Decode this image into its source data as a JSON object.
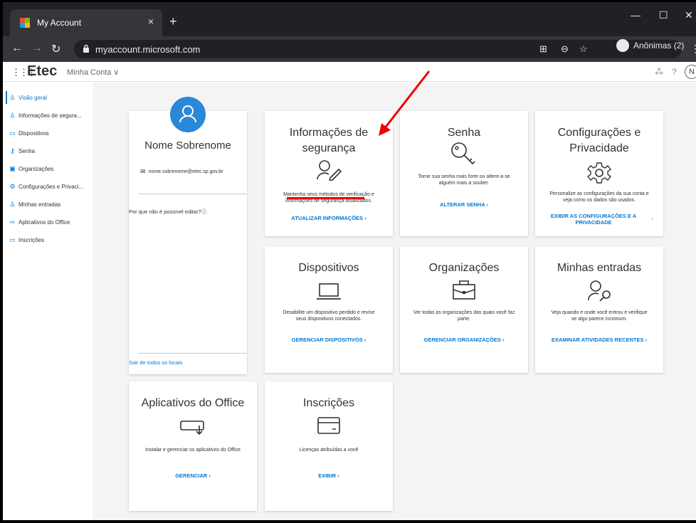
{
  "browser": {
    "tab_title": "My Account",
    "tab_close": "×",
    "new_tab": "+",
    "url": "myaccount.microsoft.com",
    "profile_label": "Anônimas (2)",
    "window_min": "—",
    "window_max": "☐",
    "window_close": "✕"
  },
  "header": {
    "brand": "Etec",
    "subtitle": "Minha Conta ∨",
    "help": "?",
    "avatar_initial": "N"
  },
  "sidebar": {
    "items": [
      {
        "label": "Visão geral",
        "icon": "person-icon"
      },
      {
        "label": "Informações de segura...",
        "icon": "security-info-icon"
      },
      {
        "label": "Dispositivos",
        "icon": "laptop-icon"
      },
      {
        "label": "Senha",
        "icon": "key-icon"
      },
      {
        "label": "Organizações",
        "icon": "briefcase-icon"
      },
      {
        "label": "Configurações e Privaci...",
        "icon": "gear-icon"
      },
      {
        "label": "Minhas entradas",
        "icon": "sign-in-icon"
      },
      {
        "label": "Aplicativos do Office",
        "icon": "office-apps-icon"
      },
      {
        "label": "Inscrições",
        "icon": "card-icon"
      }
    ]
  },
  "profile": {
    "name": "Nome Sobrenome",
    "email": "nome.sobrenome@etec.sp.gov.br",
    "why": "Por que não é possível editar?",
    "signout": "Sair de todos os locais"
  },
  "cards": {
    "security": {
      "title1": "Informações de",
      "title2": "segurança",
      "desc1": "Mantenha seus métodos de verificação e",
      "desc2": "informações de segurança atualizados.",
      "link": "ATUALIZAR INFORMAÇÕES  ›"
    },
    "password": {
      "title": "Senha",
      "desc1": "Torne sua senha mais forte ou altere-a se",
      "desc2": "alguém mais a souber.",
      "link": "ALTERAR SENHA  ›"
    },
    "privacy": {
      "title1": "Configurações e",
      "title2": "Privacidade",
      "desc1": "Personalize as configurações da sua conta e",
      "desc2": "veja como os dados são usados.",
      "link1": "EXIBIR AS CONFIGURAÇÕES E A",
      "link2": "PRIVACIDADE",
      "chevron": "›"
    },
    "devices": {
      "title": "Dispositivos",
      "desc1": "Desabilite um dispositivo perdido e revise",
      "desc2": "seus dispositivos conectados.",
      "link": "GERENCIAR DISPOSITIVOS  ›"
    },
    "orgs": {
      "title": "Organizações",
      "desc1": "Ver todas as organizações das quais você faz",
      "desc2": "parte.",
      "link": "GERENCIAR ORGANIZAÇÕES  ›"
    },
    "signins": {
      "title": "Minhas entradas",
      "desc1": "Veja quando e onde você entrou e verifique",
      "desc2": "se algo parece incomum.",
      "link": "EXAMINAR ATIVIDADES RECENTES  ›"
    },
    "office": {
      "title": "Aplicativos do Office",
      "desc1": "Instalar e gerenciar os aplicativos do Office",
      "link": "GERENCIAR  ›"
    },
    "subs": {
      "title": "Inscrições",
      "desc1": "Licenças atribuídas a você",
      "link": "EXIBIR  ›"
    }
  },
  "colors": {
    "accent": "#0078d4",
    "annotation": "#e00000"
  }
}
